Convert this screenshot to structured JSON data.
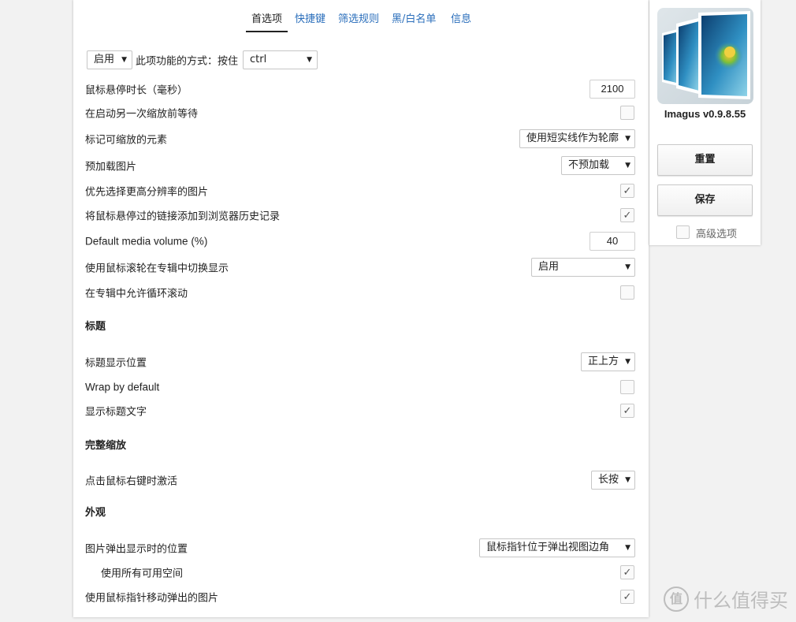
{
  "tabs": [
    "首选项",
    "快捷键",
    "筛选规则",
    "黑/白名单",
    "信息"
  ],
  "top_row": {
    "mode_select": "启用",
    "method_label": "此项功能的方式：按住",
    "key_select": "ctrl"
  },
  "settings": {
    "hover_delay_label": "鼠标悬停时长（毫秒）",
    "hover_delay_value": "2100",
    "wait_zoom_label": "在启动另一次缩放前等待",
    "mark_label": "标记可缩放的元素",
    "mark_select": "使用短实线作为轮廓",
    "preload_label": "预加载图片",
    "preload_select": "不预加载",
    "hires_label": "优先选择更高分辨率的图片",
    "history_label": "将鼠标悬停过的链接添加到浏览器历史记录",
    "volume_label": "Default media volume (%)",
    "volume_value": "40",
    "album_wheel_label": "使用鼠标滚轮在专辑中切换显示",
    "album_wheel_select": "启用",
    "loop_label": "在专辑中允许循环滚动"
  },
  "sections": {
    "caption": "标题",
    "fullzoom": "完整缩放",
    "appearance": "外观"
  },
  "caption": {
    "position_label": "标题显示位置",
    "position_select": "正上方",
    "wrap_label": "Wrap by default",
    "show_label": "显示标题文字"
  },
  "fullzoom": {
    "rightclick_label": "点击鼠标右键时激活",
    "rightclick_select": "长按"
  },
  "appearance": {
    "popup_pos_label": "图片弹出显示时的位置",
    "popup_pos_select": "鼠标指针位于弹出视图边角",
    "use_space_label": "使用所有可用空间",
    "move_popup_label": "使用鼠标指针移动弹出的图片"
  },
  "checkmark": "✓",
  "dropdown_arrow": "▼",
  "sidebar": {
    "app_name": "Imagus v0.9.8.55",
    "reset": "重置",
    "save": "保存",
    "advanced": "高级选项"
  },
  "watermark": {
    "icon_char": "值",
    "text": "什么值得买"
  }
}
